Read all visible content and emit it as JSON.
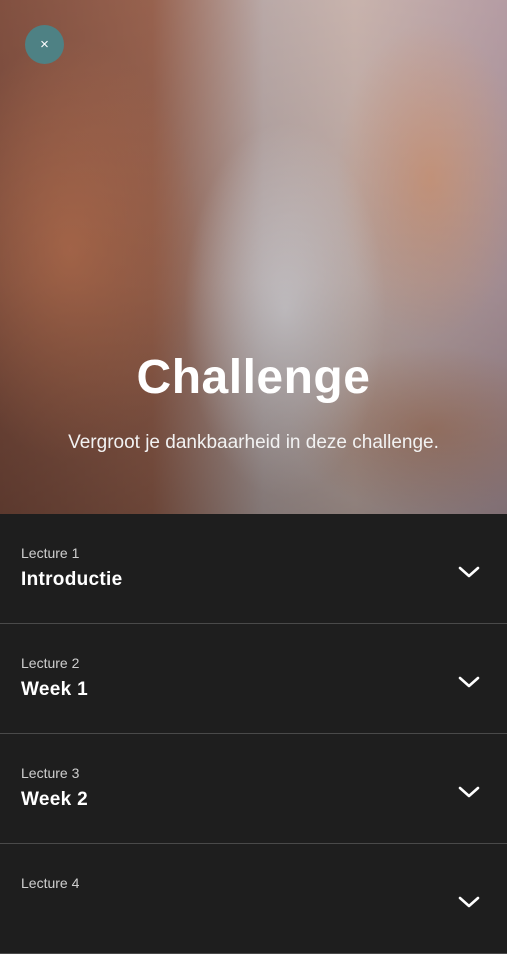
{
  "header": {
    "close_label": "×",
    "title": "Challenge",
    "subtitle": "Vergroot je dankbaarheid in deze challenge."
  },
  "lectures": [
    {
      "label": "Lecture 1",
      "title": "Introductie"
    },
    {
      "label": "Lecture 2",
      "title": "Week 1"
    },
    {
      "label": "Lecture 3",
      "title": "Week 2"
    },
    {
      "label": "Lecture 4",
      "title": ""
    }
  ],
  "colors": {
    "close_button_bg": "#4e8184",
    "list_bg": "#1e1e1e",
    "divider": "#4a4a4a"
  },
  "icons": {
    "close": "close-icon",
    "expand": "chevron-down-icon"
  }
}
